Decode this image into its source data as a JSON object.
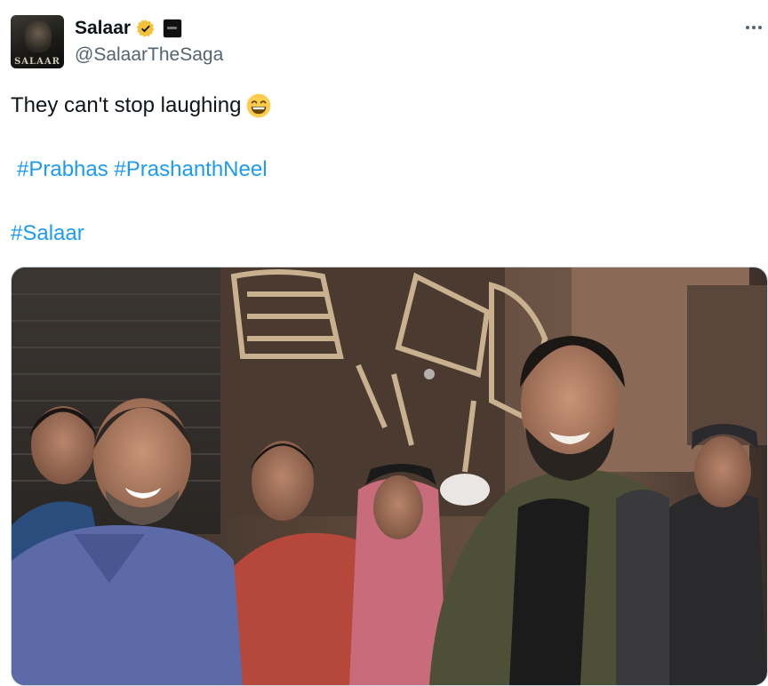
{
  "author": {
    "display_name": "Salaar",
    "handle": "@SalaarTheSaga",
    "avatar_text": "SALAAR",
    "verified": true,
    "verified_badge_color": "#f4c13a",
    "affiliation_icon": "studio-badge-icon"
  },
  "tweet": {
    "text": "They can't stop laughing",
    "emoji": "grinning-face-with-smiling-eyes",
    "hashtags_line1": [
      "#Prabhas",
      "#PrashanthNeel"
    ],
    "hashtags_line2": [
      "#Salaar"
    ]
  },
  "menu": {
    "icon": "more-options-icon"
  },
  "media": {
    "type": "photo",
    "icon": "tweet-photo"
  },
  "colors": {
    "link": "#1d9bf0",
    "text": "#0f1419",
    "muted": "#536471",
    "border": "#cfd9de"
  }
}
